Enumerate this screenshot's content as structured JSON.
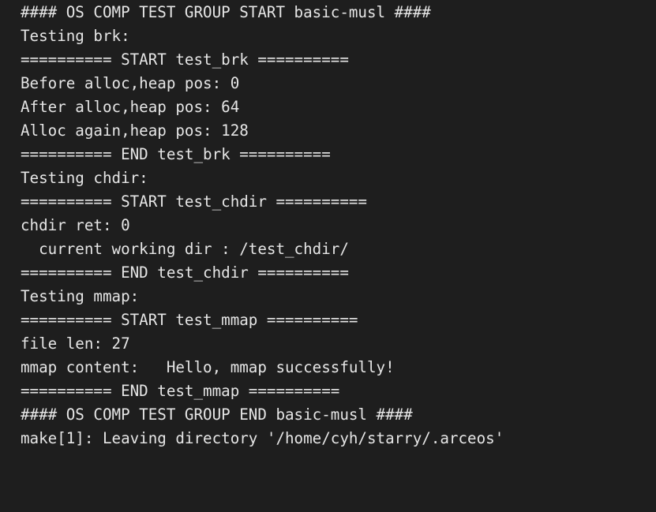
{
  "terminal": {
    "lines": [
      "#### OS COMP TEST GROUP START basic-musl ####",
      "Testing brk:",
      "========== START test_brk ==========",
      "Before alloc,heap pos: 0",
      "After alloc,heap pos: 64",
      "Alloc again,heap pos: 128",
      "========== END test_brk ==========",
      "Testing chdir:",
      "========== START test_chdir ==========",
      "chdir ret: 0",
      "  current working dir : /test_chdir/",
      "========== END test_chdir ==========",
      "Testing mmap:",
      "========== START test_mmap ==========",
      "file len: 27",
      "mmap content:   Hello, mmap successfully!",
      "========== END test_mmap ==========",
      "#### OS COMP TEST GROUP END basic-musl ####",
      "make[1]: Leaving directory '/home/cyh/starry/.arceos'"
    ]
  }
}
